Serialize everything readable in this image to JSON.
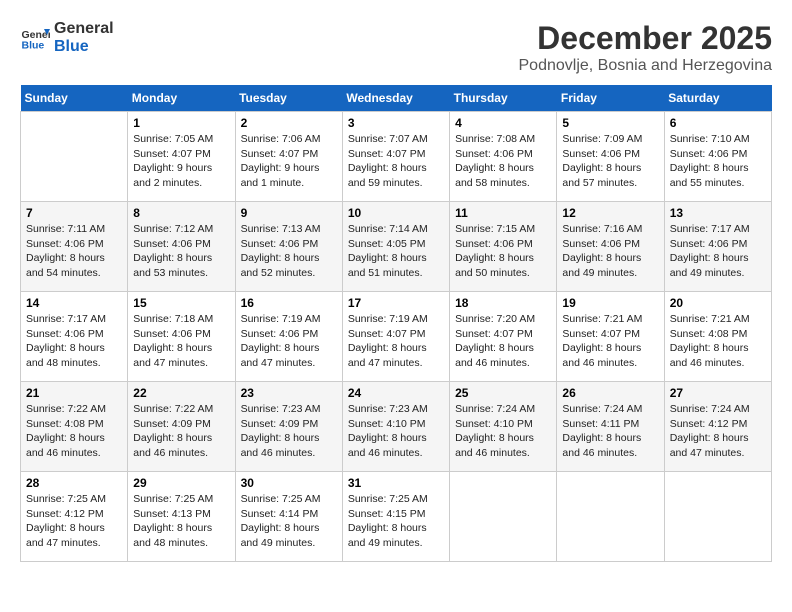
{
  "header": {
    "logo_line1": "General",
    "logo_line2": "Blue",
    "month": "December 2025",
    "location": "Podnovlje, Bosnia and Herzegovina"
  },
  "days_of_week": [
    "Sunday",
    "Monday",
    "Tuesday",
    "Wednesday",
    "Thursday",
    "Friday",
    "Saturday"
  ],
  "weeks": [
    [
      {
        "day": "",
        "content": ""
      },
      {
        "day": "1",
        "content": "Sunrise: 7:05 AM\nSunset: 4:07 PM\nDaylight: 9 hours\nand 2 minutes."
      },
      {
        "day": "2",
        "content": "Sunrise: 7:06 AM\nSunset: 4:07 PM\nDaylight: 9 hours\nand 1 minute."
      },
      {
        "day": "3",
        "content": "Sunrise: 7:07 AM\nSunset: 4:07 PM\nDaylight: 8 hours\nand 59 minutes."
      },
      {
        "day": "4",
        "content": "Sunrise: 7:08 AM\nSunset: 4:06 PM\nDaylight: 8 hours\nand 58 minutes."
      },
      {
        "day": "5",
        "content": "Sunrise: 7:09 AM\nSunset: 4:06 PM\nDaylight: 8 hours\nand 57 minutes."
      },
      {
        "day": "6",
        "content": "Sunrise: 7:10 AM\nSunset: 4:06 PM\nDaylight: 8 hours\nand 55 minutes."
      }
    ],
    [
      {
        "day": "7",
        "content": "Sunrise: 7:11 AM\nSunset: 4:06 PM\nDaylight: 8 hours\nand 54 minutes."
      },
      {
        "day": "8",
        "content": "Sunrise: 7:12 AM\nSunset: 4:06 PM\nDaylight: 8 hours\nand 53 minutes."
      },
      {
        "day": "9",
        "content": "Sunrise: 7:13 AM\nSunset: 4:06 PM\nDaylight: 8 hours\nand 52 minutes."
      },
      {
        "day": "10",
        "content": "Sunrise: 7:14 AM\nSunset: 4:05 PM\nDaylight: 8 hours\nand 51 minutes."
      },
      {
        "day": "11",
        "content": "Sunrise: 7:15 AM\nSunset: 4:06 PM\nDaylight: 8 hours\nand 50 minutes."
      },
      {
        "day": "12",
        "content": "Sunrise: 7:16 AM\nSunset: 4:06 PM\nDaylight: 8 hours\nand 49 minutes."
      },
      {
        "day": "13",
        "content": "Sunrise: 7:17 AM\nSunset: 4:06 PM\nDaylight: 8 hours\nand 49 minutes."
      }
    ],
    [
      {
        "day": "14",
        "content": "Sunrise: 7:17 AM\nSunset: 4:06 PM\nDaylight: 8 hours\nand 48 minutes."
      },
      {
        "day": "15",
        "content": "Sunrise: 7:18 AM\nSunset: 4:06 PM\nDaylight: 8 hours\nand 47 minutes."
      },
      {
        "day": "16",
        "content": "Sunrise: 7:19 AM\nSunset: 4:06 PM\nDaylight: 8 hours\nand 47 minutes."
      },
      {
        "day": "17",
        "content": "Sunrise: 7:19 AM\nSunset: 4:07 PM\nDaylight: 8 hours\nand 47 minutes."
      },
      {
        "day": "18",
        "content": "Sunrise: 7:20 AM\nSunset: 4:07 PM\nDaylight: 8 hours\nand 46 minutes."
      },
      {
        "day": "19",
        "content": "Sunrise: 7:21 AM\nSunset: 4:07 PM\nDaylight: 8 hours\nand 46 minutes."
      },
      {
        "day": "20",
        "content": "Sunrise: 7:21 AM\nSunset: 4:08 PM\nDaylight: 8 hours\nand 46 minutes."
      }
    ],
    [
      {
        "day": "21",
        "content": "Sunrise: 7:22 AM\nSunset: 4:08 PM\nDaylight: 8 hours\nand 46 minutes."
      },
      {
        "day": "22",
        "content": "Sunrise: 7:22 AM\nSunset: 4:09 PM\nDaylight: 8 hours\nand 46 minutes."
      },
      {
        "day": "23",
        "content": "Sunrise: 7:23 AM\nSunset: 4:09 PM\nDaylight: 8 hours\nand 46 minutes."
      },
      {
        "day": "24",
        "content": "Sunrise: 7:23 AM\nSunset: 4:10 PM\nDaylight: 8 hours\nand 46 minutes."
      },
      {
        "day": "25",
        "content": "Sunrise: 7:24 AM\nSunset: 4:10 PM\nDaylight: 8 hours\nand 46 minutes."
      },
      {
        "day": "26",
        "content": "Sunrise: 7:24 AM\nSunset: 4:11 PM\nDaylight: 8 hours\nand 46 minutes."
      },
      {
        "day": "27",
        "content": "Sunrise: 7:24 AM\nSunset: 4:12 PM\nDaylight: 8 hours\nand 47 minutes."
      }
    ],
    [
      {
        "day": "28",
        "content": "Sunrise: 7:25 AM\nSunset: 4:12 PM\nDaylight: 8 hours\nand 47 minutes."
      },
      {
        "day": "29",
        "content": "Sunrise: 7:25 AM\nSunset: 4:13 PM\nDaylight: 8 hours\nand 48 minutes."
      },
      {
        "day": "30",
        "content": "Sunrise: 7:25 AM\nSunset: 4:14 PM\nDaylight: 8 hours\nand 49 minutes."
      },
      {
        "day": "31",
        "content": "Sunrise: 7:25 AM\nSunset: 4:15 PM\nDaylight: 8 hours\nand 49 minutes."
      },
      {
        "day": "",
        "content": ""
      },
      {
        "day": "",
        "content": ""
      },
      {
        "day": "",
        "content": ""
      }
    ]
  ]
}
